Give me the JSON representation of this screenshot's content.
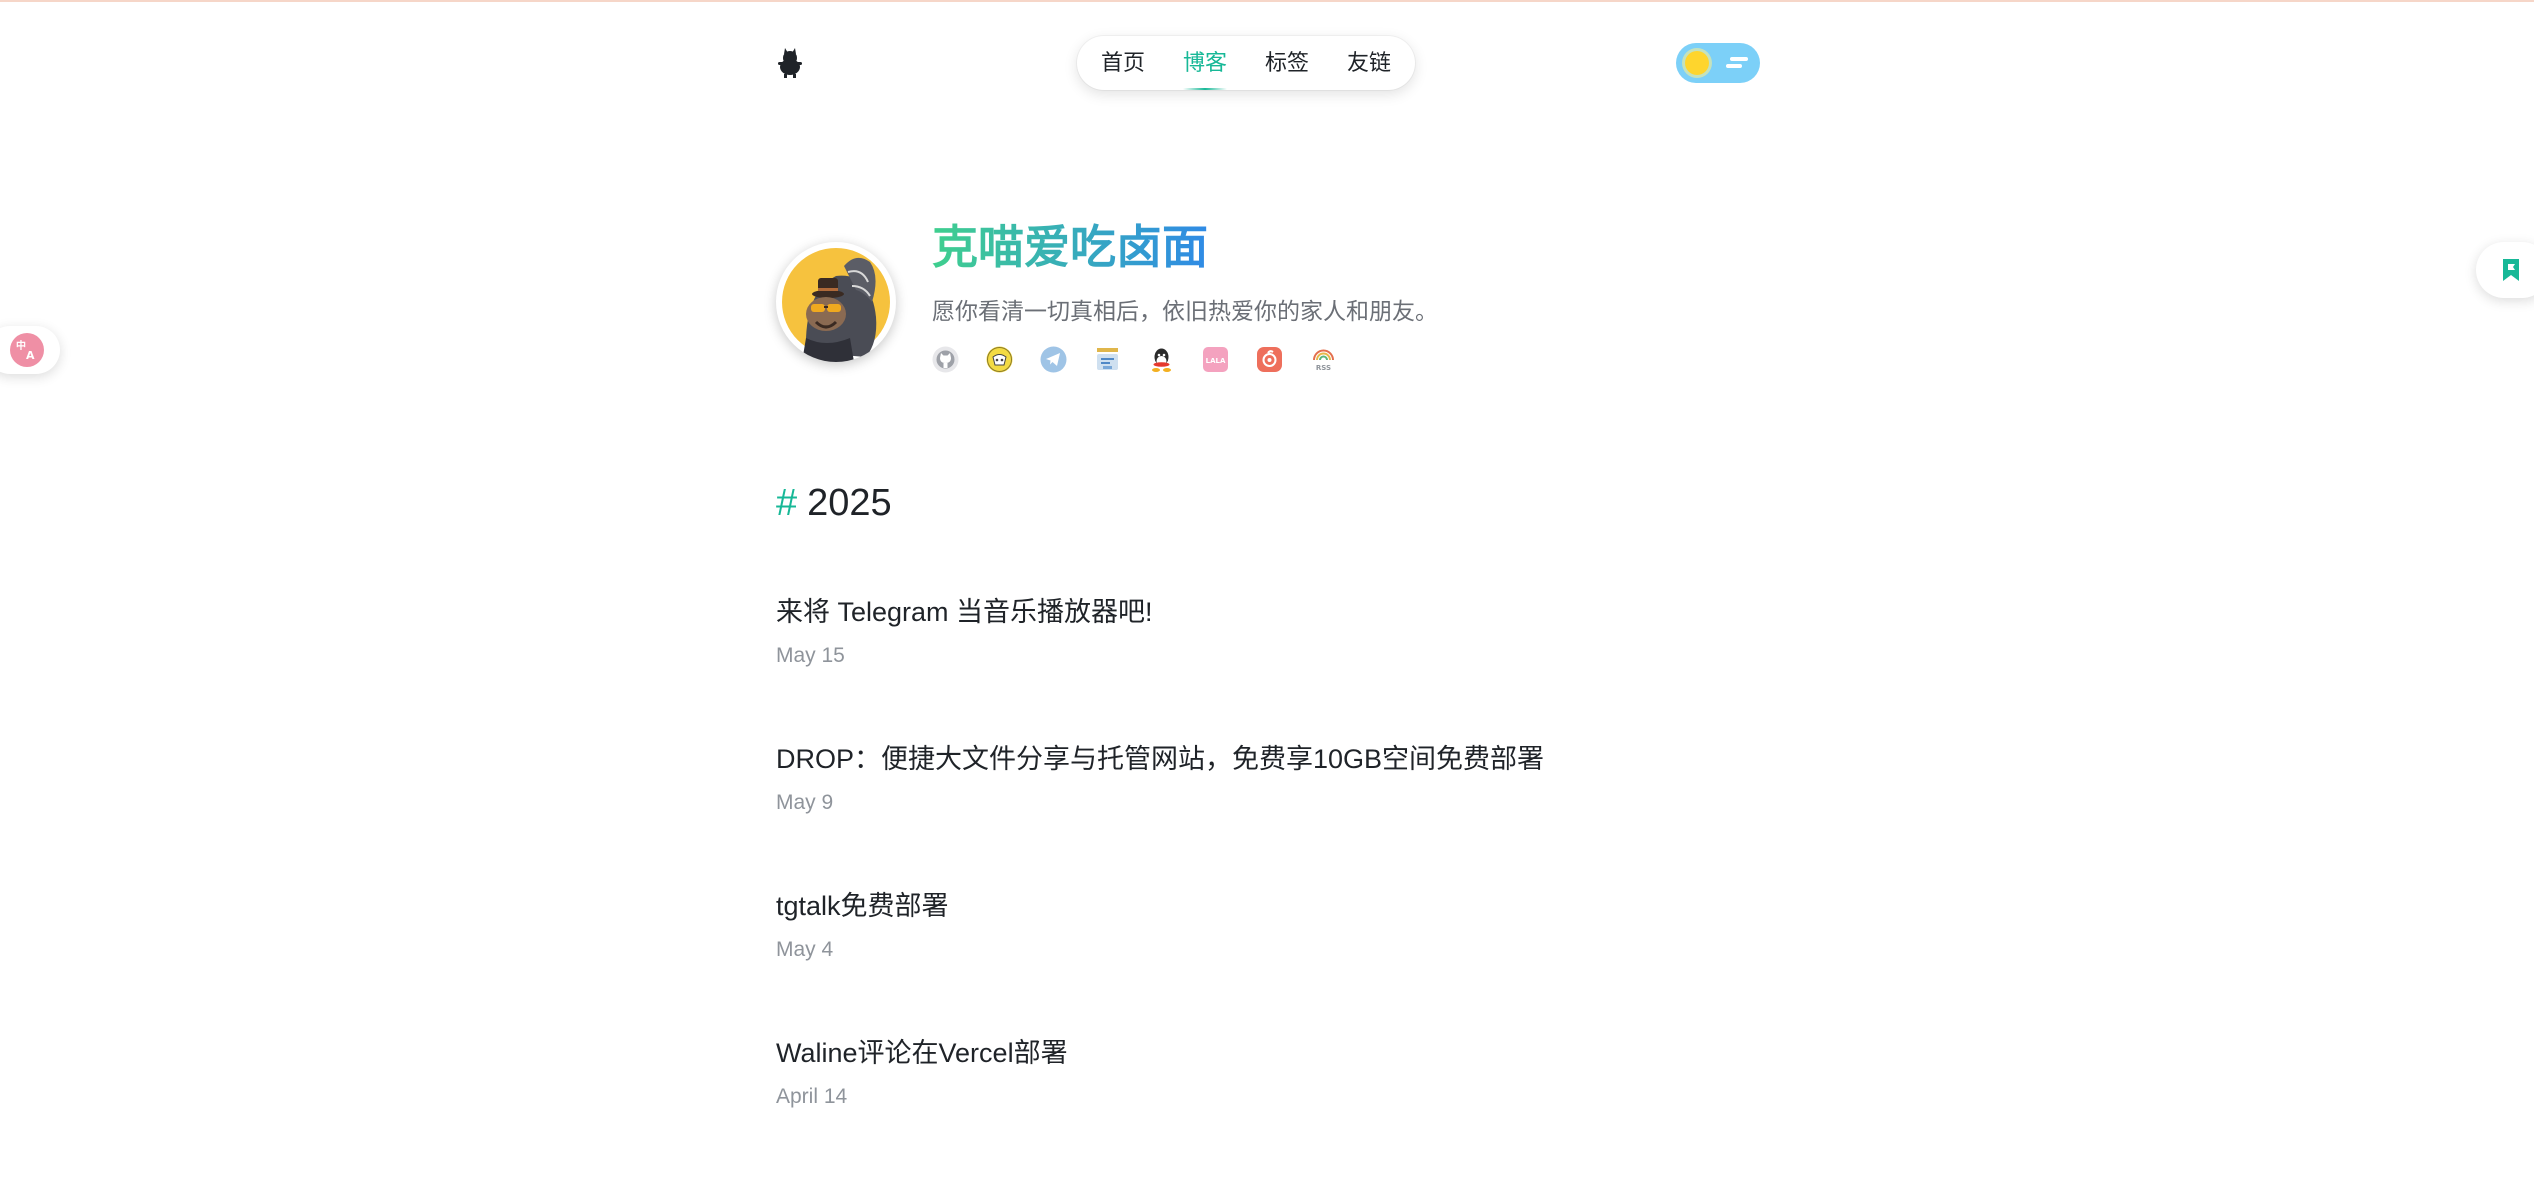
{
  "header": {
    "logo_icon": "cat-logo-icon",
    "nav": [
      {
        "label": "首页",
        "active": false
      },
      {
        "label": "博客",
        "active": true
      },
      {
        "label": "标签",
        "active": false
      },
      {
        "label": "友链",
        "active": false
      }
    ],
    "theme_toggle_icon": "sun-cloud-toggle-icon"
  },
  "side": {
    "translate_icon": "translate-icon",
    "bookmark_icon": "bookmark-icon"
  },
  "profile": {
    "name": "克喵爱吃卤面",
    "motto": "愿你看清一切真相后，依旧热爱你的家人和朋友。",
    "social_icons": [
      "github-icon",
      "bilibili-icon",
      "telegram-icon",
      "blog-icon",
      "qq-icon",
      "lala-icon",
      "netease-music-icon",
      "rss-icon"
    ],
    "rss_label": "RSS",
    "lala_label": "LALA"
  },
  "posts": {
    "year_hash": "#",
    "year": "2025",
    "items": [
      {
        "title": "来将 Telegram 当音乐播放器吧!",
        "date": "May 15"
      },
      {
        "title": "DROP：便捷大文件分享与托管网站，免费享10GB空间免费部署",
        "date": "May 9"
      },
      {
        "title": "tgtalk免费部署",
        "date": "May 4"
      },
      {
        "title": "Waline评论在Vercel部署",
        "date": "April 14"
      }
    ]
  },
  "colors": {
    "accent": "#17b897",
    "name_gradient_start": "#3fcf8e",
    "name_gradient_end": "#2f8ae6",
    "toggle_bg": "#7cd0f8",
    "sun": "#fed52d",
    "translate_bg": "#ef8fa5"
  }
}
